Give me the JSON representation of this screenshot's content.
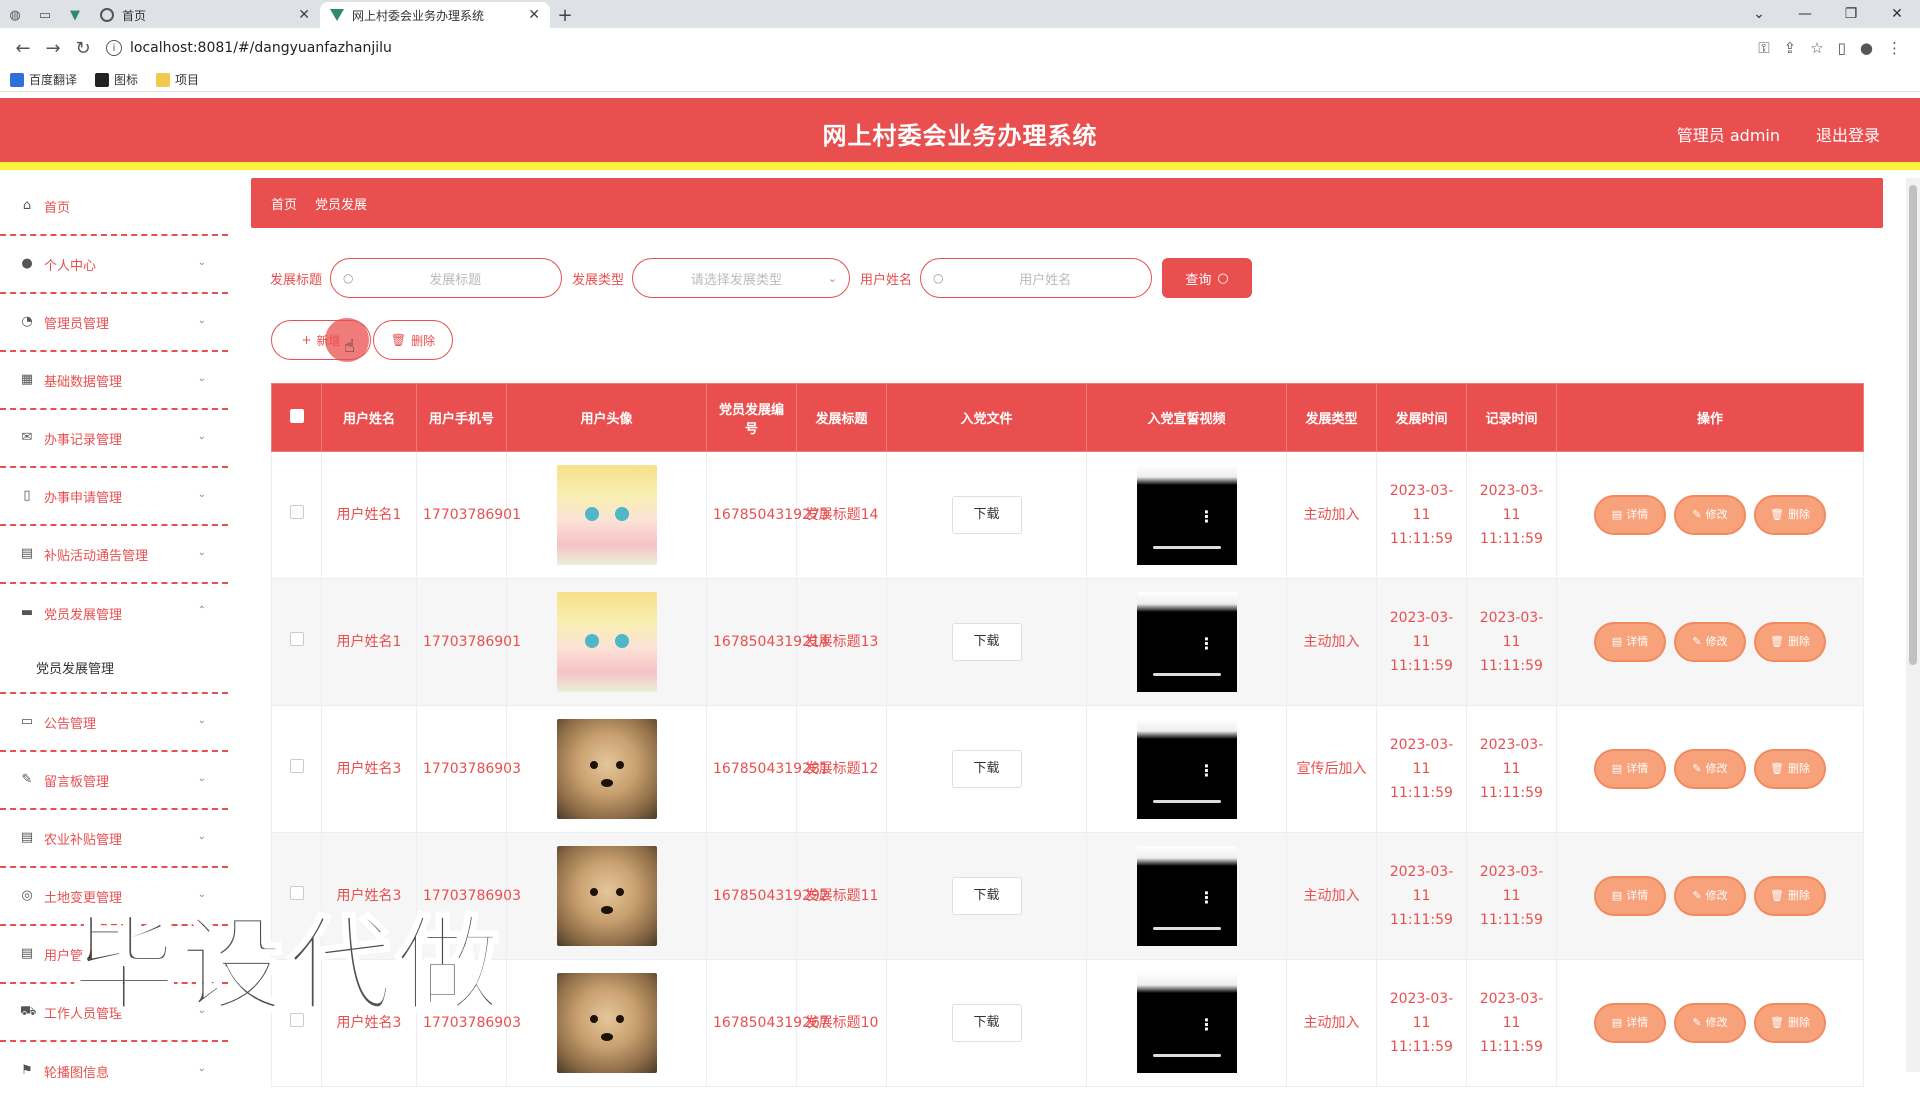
{
  "browser": {
    "tabs": [
      {
        "title": "首页"
      },
      {
        "title": "网上村委会业务办理系统",
        "active": true
      }
    ],
    "url": "localhost:8081/#/dangyuanfazhanjilu",
    "bookmarks": [
      "百度翻译",
      "图标",
      "项目"
    ]
  },
  "header": {
    "title": "网上村委会业务办理系统",
    "user": "管理员 admin",
    "logout": "退出登录"
  },
  "sidebar": {
    "items": [
      {
        "label": "首页",
        "icon": "home-icon"
      },
      {
        "label": "个人中心",
        "icon": "user-icon"
      },
      {
        "label": "管理员管理",
        "icon": "gauge-icon"
      },
      {
        "label": "基础数据管理",
        "icon": "grid-icon"
      },
      {
        "label": "办事记录管理",
        "icon": "mail-icon"
      },
      {
        "label": "办事申请管理",
        "icon": "phone-icon"
      },
      {
        "label": "补贴活动通告管理",
        "icon": "clipboard-icon"
      },
      {
        "label": "党员发展管理",
        "icon": "monitor-icon"
      },
      {
        "label": "公告管理",
        "icon": "message-icon"
      },
      {
        "label": "留言板管理",
        "icon": "pen-icon"
      },
      {
        "label": "农业补贴管理",
        "icon": "clipboard-icon"
      },
      {
        "label": "土地变更管理",
        "icon": "target-icon"
      },
      {
        "label": "用户管理",
        "icon": "clipboard-icon"
      },
      {
        "label": "工作人员管理",
        "icon": "cart-icon"
      },
      {
        "label": "轮播图信息",
        "icon": "flag-icon"
      }
    ],
    "sub_item": "党员发展管理"
  },
  "breadcrumb": {
    "home": "首页",
    "current": "党员发展"
  },
  "search": {
    "title_label": "发展标题",
    "title_placeholder": "发展标题",
    "type_label": "发展类型",
    "type_placeholder": "请选择发展类型",
    "name_label": "用户姓名",
    "name_placeholder": "用户姓名",
    "query_button": "查询"
  },
  "actions": {
    "add": "新增",
    "delete": "删除"
  },
  "table": {
    "headers": [
      "用户姓名",
      "用户手机号",
      "用户头像",
      "党员发展编号",
      "发展标题",
      "入党文件",
      "入党宣誓视频",
      "发展类型",
      "发展时间",
      "记录时间",
      "操作"
    ],
    "download_label": "下载",
    "op_labels": {
      "detail": "详情",
      "edit": "修改",
      "delete": "删除"
    },
    "rows": [
      {
        "name": "用户姓名1",
        "phone": "17703786901",
        "avatar": "anime",
        "code": "1678504319273",
        "title": "发展标题14",
        "type": "主动加入",
        "dev_time": "2023-03-11 11:11:59",
        "rec_time": "2023-03-11 11:11:59"
      },
      {
        "name": "用户姓名1",
        "phone": "17703786901",
        "avatar": "anime",
        "code": "1678504319214",
        "title": "发展标题13",
        "type": "主动加入",
        "dev_time": "2023-03-11 11:11:59",
        "rec_time": "2023-03-11 11:11:59"
      },
      {
        "name": "用户姓名3",
        "phone": "17703786903",
        "avatar": "dog",
        "code": "1678504319281",
        "title": "发展标题12",
        "type": "宣传后加入",
        "dev_time": "2023-03-11 11:11:59",
        "rec_time": "2023-03-11 11:11:59"
      },
      {
        "name": "用户姓名3",
        "phone": "17703786903",
        "avatar": "dog",
        "code": "1678504319292",
        "title": "发展标题11",
        "type": "主动加入",
        "dev_time": "2023-03-11 11:11:59",
        "rec_time": "2023-03-11 11:11:59"
      },
      {
        "name": "用户姓名3",
        "phone": "17703786903",
        "avatar": "dog",
        "code": "1678504319267",
        "title": "发展标题10",
        "type": "主动加入",
        "dev_time": "2023-03-11 11:11:59",
        "rec_time": "2023-03-11 11:11:59"
      }
    ]
  },
  "watermark": "毕设代做",
  "colors": {
    "primary": "#e94f4f",
    "accent_line": "#fff23a",
    "op_button": "#f7a27b"
  }
}
